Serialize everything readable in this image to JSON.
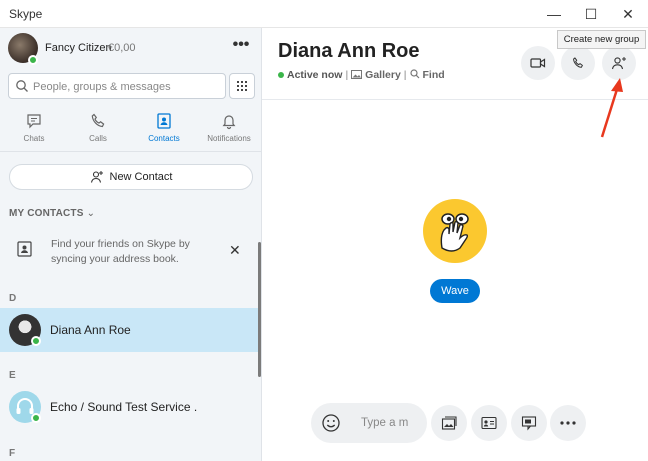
{
  "window": {
    "title": "Skype",
    "controls": {
      "minimize": "—",
      "maximize": "☐",
      "close": "✕"
    }
  },
  "profile": {
    "name": "Fancy Citizen",
    "credit": "€0,00",
    "more_label": "•••"
  },
  "search": {
    "placeholder": "People, groups & messages"
  },
  "nav_tabs": [
    {
      "label": "Chats",
      "icon": "chat-icon",
      "active": false
    },
    {
      "label": "Calls",
      "icon": "phone-icon",
      "active": false
    },
    {
      "label": "Contacts",
      "icon": "contacts-icon",
      "active": true
    },
    {
      "label": "Notifications",
      "icon": "bell-icon",
      "active": false
    }
  ],
  "new_contact_label": "New Contact",
  "my_contacts": {
    "heading": "MY CONTACTS",
    "chevron": "⌄",
    "sync_text": "Find your friends on Skype by syncing your address book.",
    "dismiss": "✕"
  },
  "groups": [
    {
      "letter": "D",
      "contacts": [
        {
          "name": "Diana Ann Roe",
          "selected": true,
          "online": true
        }
      ]
    },
    {
      "letter": "E",
      "contacts": [
        {
          "name": "Echo / Sound Test Service .",
          "selected": false,
          "online": true
        }
      ]
    },
    {
      "letter": "F",
      "contacts": []
    }
  ],
  "chat": {
    "title": "Diana Ann Roe",
    "status": "Active now",
    "gallery_label": "Gallery",
    "find_label": "Find",
    "separator": "|",
    "wave_label": "Wave",
    "compose_placeholder": "Type a m",
    "tooltip": "Create new group"
  },
  "colors": {
    "accent": "#0078d4",
    "online": "#3bb54a",
    "selected_row": "#c9e7f7",
    "sidebar_bg": "#f2f5f8",
    "arrow": "#e8381e"
  }
}
